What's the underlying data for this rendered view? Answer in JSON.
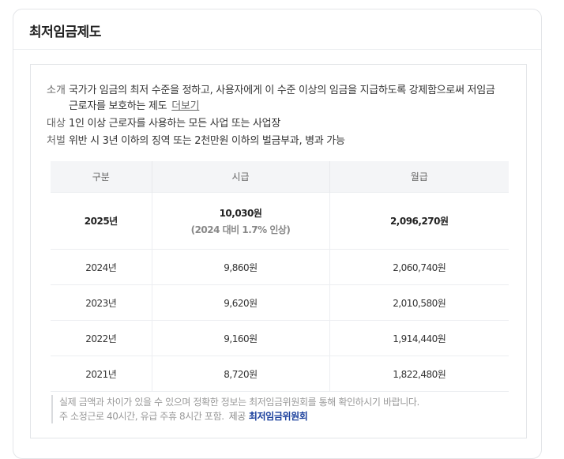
{
  "card": {
    "title": "최저임금제도"
  },
  "info": [
    {
      "label": "소개",
      "text": "국가가 임금의 최저 수준을 정하고, 사용자에게 이 수준 이상의 임금을 지급하도록 강제함으로써 저임금 근로자를 보호하는 제도",
      "more": "더보기"
    },
    {
      "label": "대상",
      "text": "1인 이상 근로자를 사용하는 모든 사업 또는 사업장"
    },
    {
      "label": "처벌",
      "text": "위반 시 3년 이하의 징역 또는 2천만원 이하의 벌금부과, 병과 가능"
    }
  ],
  "table": {
    "headers": [
      "구분",
      "시급",
      "월급"
    ],
    "highlight": {
      "year": "2025년",
      "hourly": "10,030원",
      "hourly_note": "(2024 대비 1.7% 인상)",
      "monthly": "2,096,270원"
    },
    "rows": [
      {
        "year": "2024년",
        "hourly": "9,860원",
        "monthly": "2,060,740원"
      },
      {
        "year": "2023년",
        "hourly": "9,620원",
        "monthly": "2,010,580원"
      },
      {
        "year": "2022년",
        "hourly": "9,160원",
        "monthly": "1,914,440원"
      },
      {
        "year": "2021년",
        "hourly": "8,720원",
        "monthly": "1,822,480원"
      }
    ]
  },
  "note": {
    "line1": "실제 금액과 차이가 있을 수 있으며 정확한 정보는 최저임금위원회를 통해 확인하시기 바랍니다.",
    "line2": "주 소정근로 40시간, 유급 주휴 8시간 포함.",
    "provider_label": "제공",
    "provider_name": "최저임금위원회"
  }
}
